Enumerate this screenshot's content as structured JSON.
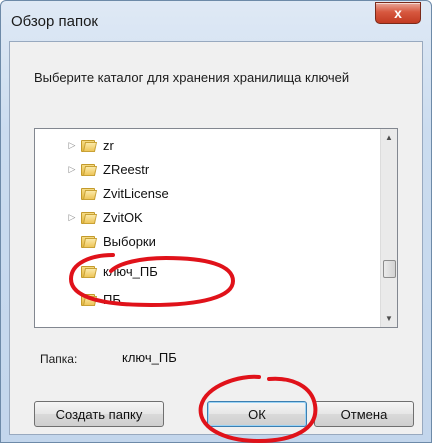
{
  "dialog": {
    "title": "Обзор папок",
    "close_label": "x",
    "prompt": "Выберите каталог для хранения хранилища ключей"
  },
  "tree": {
    "items": [
      {
        "label": "zr",
        "expandable": true
      },
      {
        "label": "ZReestr",
        "expandable": true
      },
      {
        "label": "ZvitLicense",
        "expandable": false
      },
      {
        "label": "ZvitOK",
        "expandable": true
      },
      {
        "label": "Выборки",
        "expandable": false
      },
      {
        "label": "ключ_ПБ",
        "expandable": false
      },
      {
        "label": "ПБ",
        "expandable": false
      }
    ],
    "expander_glyph": "▷",
    "scroll_up": "▲",
    "scroll_down": "▼",
    "scroll_position": 0.78
  },
  "folder_field": {
    "label": "Папка:",
    "value": "ключ_ПБ"
  },
  "buttons": {
    "new_folder": "Создать папку",
    "ok": "ОК",
    "cancel": "Отмена"
  },
  "colors": {
    "annotation_red": "#e0121a",
    "ok_focus": "#3c7fb1"
  }
}
